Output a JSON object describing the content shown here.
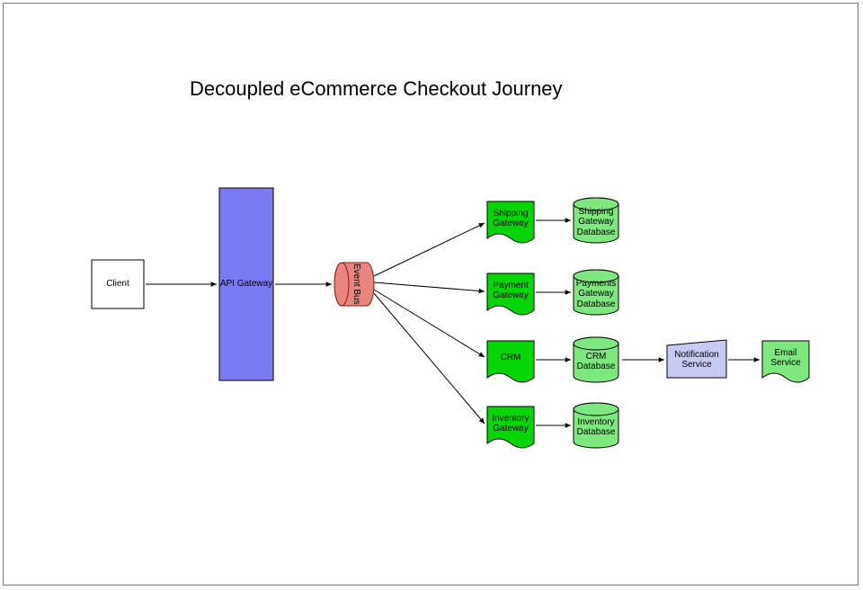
{
  "title": "Decoupled eCommerce Checkout Journey",
  "nodes": {
    "client": "Client",
    "api_gateway": "API Gateway",
    "event_bus": "Event Bus",
    "shipping_gateway": "Shipping Gateway",
    "payment_gateway": "Payment Gateway",
    "crm": "CRM",
    "inventory_gateway": "Inventory Gateway",
    "shipping_db": "Shipping Gateway Database",
    "payments_db": "Payments Gateway Database",
    "crm_db": "CRM Database",
    "inventory_db": "Inventory Database",
    "notification_service": "Notification Service",
    "email_service": "Email Service"
  },
  "colors": {
    "api_gateway_fill": "#7a7af2",
    "event_bus_fill": "#e9857f",
    "event_bus_stroke": "#8a1a12",
    "gateway_fill": "#06d506",
    "db_fill": "#7ee77e",
    "notification_fill": "#c7cbf3",
    "stroke": "#000000"
  },
  "edges": [
    [
      "client",
      "api_gateway"
    ],
    [
      "api_gateway",
      "event_bus"
    ],
    [
      "event_bus",
      "shipping_gateway"
    ],
    [
      "event_bus",
      "payment_gateway"
    ],
    [
      "event_bus",
      "crm"
    ],
    [
      "event_bus",
      "inventory_gateway"
    ],
    [
      "shipping_gateway",
      "shipping_db"
    ],
    [
      "payment_gateway",
      "payments_db"
    ],
    [
      "crm",
      "crm_db"
    ],
    [
      "inventory_gateway",
      "inventory_db"
    ],
    [
      "crm_db",
      "notification_service"
    ],
    [
      "notification_service",
      "email_service"
    ]
  ]
}
